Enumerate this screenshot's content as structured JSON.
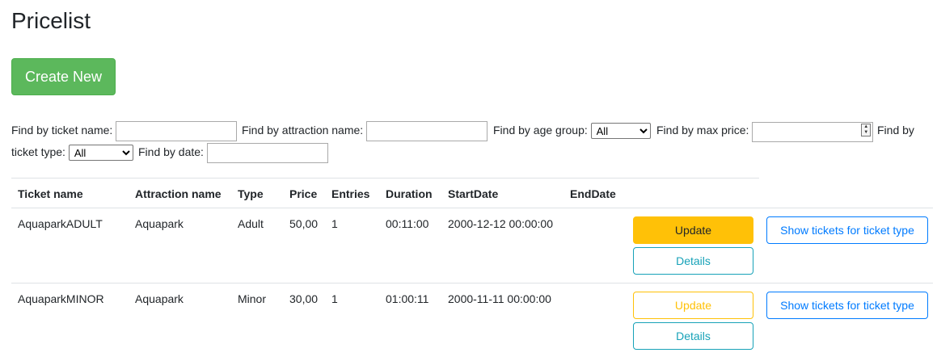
{
  "page": {
    "title": "Pricelist",
    "create_label": "Create New"
  },
  "filters": {
    "ticket_name_label": "Find by ticket name:",
    "attraction_name_label": "Find by attraction name:",
    "age_group_label": "Find by age group:",
    "age_group_value": "All",
    "max_price_label": "Find by max price:",
    "ticket_type_label_1": "Find by",
    "ticket_type_label_2": "ticket type:",
    "ticket_type_value": "All",
    "date_label": "Find by date:"
  },
  "table": {
    "headers": [
      "Ticket name",
      "Attraction name",
      "Type",
      "Price",
      "Entries",
      "Duration",
      "StartDate",
      "EndDate"
    ],
    "rows": [
      {
        "ticket_name": "AquaparkADULT",
        "attraction_name": "Aquapark",
        "type": "Adult",
        "price": "50,00",
        "entries": "1",
        "duration": "00:11:00",
        "start_date": "2000-12-12 00:00:00",
        "end_date": ""
      },
      {
        "ticket_name": "AquaparkMINOR",
        "attraction_name": "Aquapark",
        "type": "Minor",
        "price": "30,00",
        "entries": "1",
        "duration": "01:00:11",
        "start_date": "2000-11-11 00:00:00",
        "end_date": ""
      }
    ],
    "actions": {
      "update_label": "Update",
      "details_label": "Details",
      "show_tickets_label": "Show tickets for ticket type"
    }
  },
  "colors": {
    "success": "#5cb85c",
    "warning": "#ffc107",
    "info": "#17a2b8",
    "primary": "#007bff"
  }
}
